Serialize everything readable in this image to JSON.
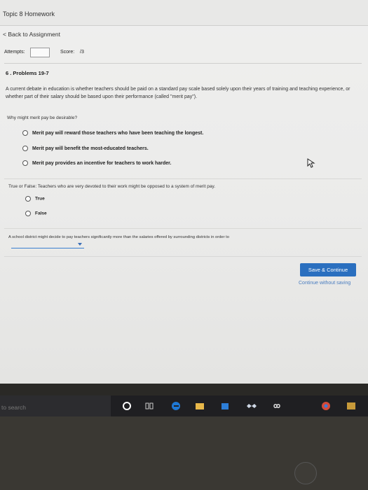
{
  "header": {
    "title": "Topic 8 Homework"
  },
  "nav": {
    "back": "< Back to Assignment"
  },
  "attempts": {
    "label": "Attempts:",
    "score_label": "Score:",
    "score_value": "/3"
  },
  "problem": {
    "title": "6 . Problems 19-7",
    "intro": "A current debate in education is whether teachers should be paid on a standard pay scale based solely upon their years of training and teaching experience, or whether part of their salary should be based upon their performance (called \"merit pay\").",
    "q1": {
      "text": "Why might merit pay be desirable?",
      "options": [
        "Merit pay will reward those teachers who have been teaching the longest.",
        "Merit pay will benefit the most-educated teachers.",
        "Merit pay provides an incentive for teachers to work harder."
      ]
    },
    "q2": {
      "text": "True or False: Teachers who are very devoted to their work might be opposed to a system of merit pay.",
      "options": [
        "True",
        "False"
      ]
    },
    "q3": {
      "text": "A school district might decide to pay teachers significantly more than the salaries offered by surrounding districts in order to"
    }
  },
  "actions": {
    "save": "Save & Continue",
    "continue_without_saving": "Continue without saving"
  },
  "taskbar": {
    "search_text": "to search",
    "icons": [
      "cortana-icon",
      "task-view-icon",
      "edge-icon",
      "file-explorer-icon",
      "store-icon",
      "dropbox-icon",
      "infinity-icon",
      "chrome-icon",
      "app-icon"
    ]
  },
  "colors": {
    "accent": "#2a6fbf",
    "link": "#4a7dbf"
  }
}
